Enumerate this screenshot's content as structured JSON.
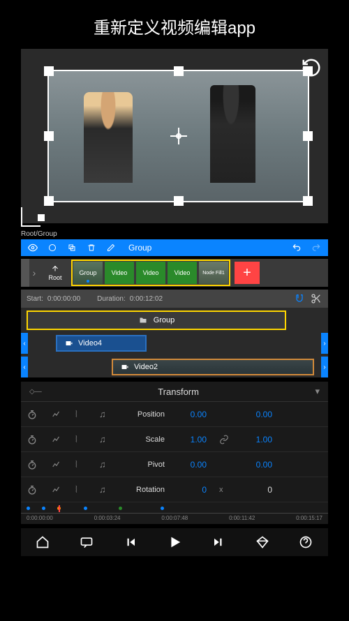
{
  "header": {
    "title": "重新定义视频编辑app"
  },
  "breadcrumb": "Root/Group",
  "toolbar": {
    "eye": "eye-icon",
    "circle": "circle-icon",
    "copy": "copy-icon",
    "trash": "trash-icon",
    "pencil": "pencil-icon",
    "label": "Group",
    "undo": "undo-icon",
    "redo": "redo-icon"
  },
  "thumbnails": {
    "root_label": "Root",
    "items": [
      "Group",
      "Video",
      "Video",
      "Video",
      "Node Fill1"
    ],
    "add": "+"
  },
  "duration": {
    "start_label": "Start:",
    "start_value": "0:00:00:00",
    "duration_label": "Duration:",
    "duration_value": "0:00:12:02"
  },
  "tracks": {
    "group_label": "Group",
    "video4": "Video4",
    "video2": "Video2"
  },
  "transform": {
    "title": "Transform",
    "rows": [
      {
        "label": "Position",
        "v1": "0.00",
        "v2": "0.00",
        "link": ""
      },
      {
        "label": "Scale",
        "v1": "1.00",
        "v2": "1.00",
        "link": "link"
      },
      {
        "label": "Pivot",
        "v1": "0.00",
        "v2": "0.00",
        "link": ""
      },
      {
        "label": "Rotation",
        "v1": "0",
        "v2": "0",
        "link": "x"
      }
    ]
  },
  "ruler": {
    "times": [
      "0:00:00:00",
      "0:00:03:24",
      "0:00:07:48",
      "0:00:11:42",
      "0:00:15:17"
    ]
  },
  "nav": {
    "home": "home",
    "chat": "chat",
    "prev": "prev",
    "play": "play",
    "next": "next",
    "diamond": "premium",
    "help": "help"
  }
}
